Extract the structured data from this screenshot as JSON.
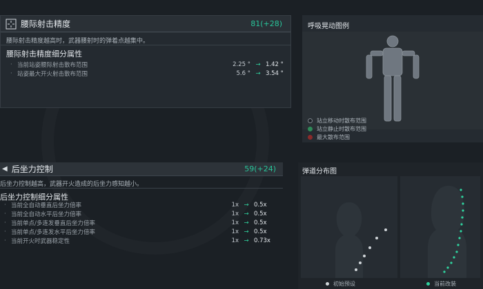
{
  "hip_fire": {
    "icon": "crosshair-icon",
    "title": "腰际射击精度",
    "value": "81(+28)",
    "description": "腰际射击精度越高时，武器腰射时的弹着点越集中。",
    "sub_title": "腰际射击精度细分属性",
    "rows": [
      {
        "label": "当前站姿腰际射击散布范围",
        "from": "2.25 °",
        "to": "1.42 °"
      },
      {
        "label": "站姿最大开火射击散布范围",
        "from": "5.6 °",
        "to": "3.54 °"
      }
    ]
  },
  "breath": {
    "title": "呼吸晃动图例",
    "legend": [
      {
        "label": "站立移动时散布范围",
        "color": "#1b2025"
      },
      {
        "label": "站立静止时散布范围",
        "color": "#2e8a58"
      },
      {
        "label": "最大散布范围",
        "color": "#8a2b2b"
      }
    ]
  },
  "recoil": {
    "icon": "recoil-arrow-icon",
    "title": "后坐力控制",
    "value": "59(+24)",
    "description": "后坐力控制越高，武器开火造成的后坐力感知越小。",
    "sub_title": "后坐力控制细分属性",
    "rows": [
      {
        "label": "当前全自动垂直后坐力倍率",
        "from": "1x",
        "to": "0.5x"
      },
      {
        "label": "当前全自动水平后坐力倍率",
        "from": "1x",
        "to": "0.5x"
      },
      {
        "label": "当前单点/多连发垂直后坐力倍率",
        "from": "1x",
        "to": "0.5x"
      },
      {
        "label": "当前单点/多连发水平后坐力倍率",
        "from": "1x",
        "to": "0.5x"
      },
      {
        "label": "当前开火时武器稳定性",
        "from": "1x",
        "to": "0.73x"
      }
    ]
  },
  "ballistic": {
    "title": "弹道分布图",
    "legend": [
      {
        "label": "初始预设",
        "color": "#cfd4d8"
      },
      {
        "label": "当前改装",
        "color": "#2fd49f"
      }
    ]
  }
}
